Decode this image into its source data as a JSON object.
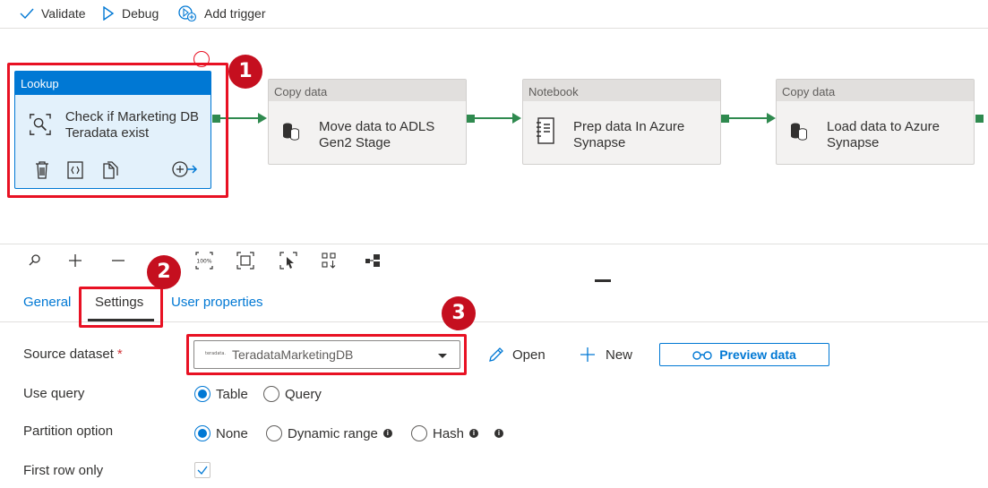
{
  "toolbar": {
    "validate": "Validate",
    "debug": "Debug",
    "add_trigger": "Add trigger"
  },
  "pipeline": {
    "lookup": {
      "type": "Lookup",
      "name": "Check if Marketing DB Teradata exist"
    },
    "activities": [
      {
        "type": "Copy data",
        "name": "Move data to ADLS Gen2 Stage",
        "icon": "database-icon"
      },
      {
        "type": "Notebook",
        "name": "Prep data In Azure Synapse",
        "icon": "notebook-icon"
      },
      {
        "type": "Copy data",
        "name": "Load data to Azure Synapse",
        "icon": "database-icon"
      }
    ]
  },
  "zoom": {
    "percent": "100%"
  },
  "tabs": {
    "general": "General",
    "settings": "Settings",
    "user_properties": "User properties"
  },
  "form": {
    "source_dataset_label": "Source dataset",
    "required_mark": "*",
    "source_dataset_value": "TeradataMarketingDB",
    "source_logo_text": "teradata.",
    "open": "Open",
    "new": "New",
    "preview": "Preview data",
    "use_query_label": "Use query",
    "use_query_options": [
      "Table",
      "Query"
    ],
    "partition_label": "Partition option",
    "partition_options": [
      "None",
      "Dynamic range",
      "Hash"
    ],
    "first_row_label": "First row only"
  },
  "callouts": [
    "1",
    "2",
    "3"
  ],
  "colors": {
    "accent": "#0078d4",
    "callout": "#c50f1f",
    "highlight": "#e81123",
    "connector": "#2f8a4f"
  }
}
